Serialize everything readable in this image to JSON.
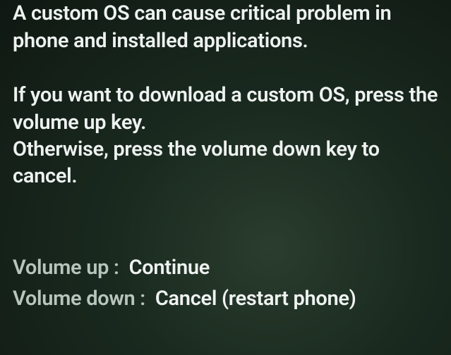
{
  "warning": {
    "line1": "A custom OS can cause critical problem in phone and installed applications."
  },
  "instruction": {
    "line1": "If you want to download a custom OS, press the volume up key.",
    "line2": "Otherwise, press the volume down key to cancel."
  },
  "actions": {
    "volume_up": {
      "label": "Volume up :",
      "value": "Continue"
    },
    "volume_down": {
      "label": "Volume down :",
      "value": "Cancel (restart phone)"
    }
  }
}
